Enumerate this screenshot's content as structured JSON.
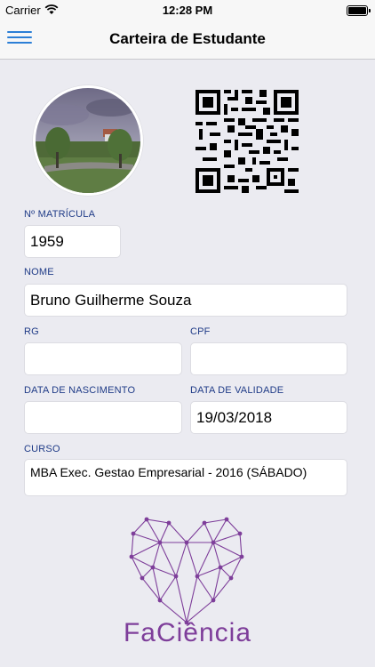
{
  "status_bar": {
    "carrier": "Carrier",
    "time": "12:28 PM"
  },
  "nav": {
    "title": "Carteira de Estudante"
  },
  "form": {
    "matricula": {
      "label": "Nº MATRÍCULA",
      "value": "1959"
    },
    "nome": {
      "label": "NOME",
      "value": "Bruno Guilherme Souza"
    },
    "rg": {
      "label": "RG",
      "value": ""
    },
    "cpf": {
      "label": "CPF",
      "value": ""
    },
    "nascimento": {
      "label": "DATA DE NASCIMENTO",
      "value": ""
    },
    "validade": {
      "label": "DATA DE VALIDADE",
      "value": "19/03/2018"
    },
    "curso": {
      "label": "CURSO",
      "value": "MBA Exec. Gestao Empresarial - 2016 (SÁBADO)"
    }
  },
  "logo": {
    "text": "FaCiência"
  },
  "icons": [
    "menu-icon",
    "wifi-icon",
    "battery-icon",
    "qr-code",
    "profile-photo",
    "faciencia-logo"
  ],
  "colors": {
    "label_blue": "#1f3b87",
    "accent_blue": "#2c7fd6",
    "brand_purple": "#7e3e9a"
  }
}
